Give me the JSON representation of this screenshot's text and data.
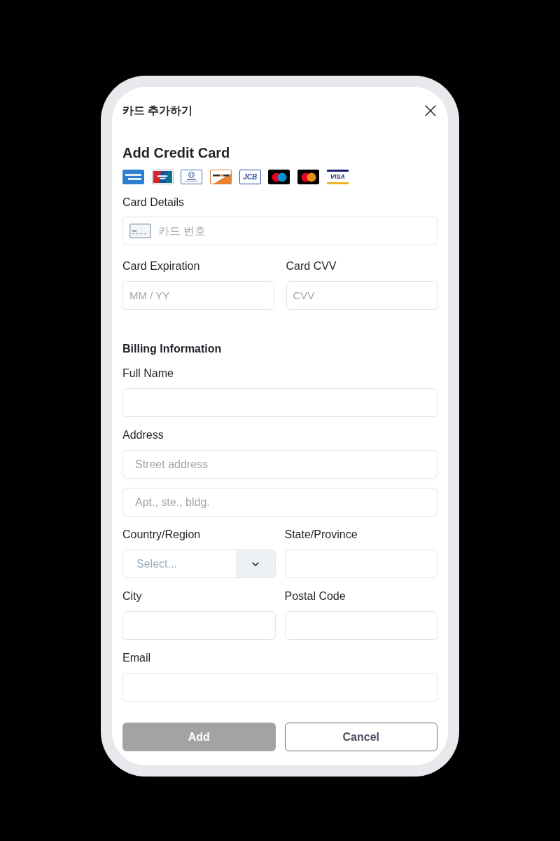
{
  "header": {
    "title": "카드 추가하기"
  },
  "card_form": {
    "title": "Add Credit Card",
    "card_brands": [
      {
        "kind": "amex"
      },
      {
        "kind": "unionpay"
      },
      {
        "kind": "diners"
      },
      {
        "kind": "discover"
      },
      {
        "kind": "jcb",
        "label": "JCB"
      },
      {
        "kind": "maestro"
      },
      {
        "kind": "mastercard"
      },
      {
        "kind": "visa",
        "label": "VISA"
      }
    ],
    "card_details": {
      "label": "Card Details",
      "placeholder": "카드 번호"
    },
    "card_fields": [
      {
        "label": "Card Expiration",
        "placeholder": "MM / YY"
      },
      {
        "label": "Card CVV",
        "placeholder": "CVV"
      }
    ]
  },
  "billing": {
    "title": "Billing Information",
    "rows": [
      [
        {
          "kind": "input",
          "label": "Full Name"
        }
      ],
      [
        {
          "kind": "address",
          "label": "Address",
          "placeholders": [
            "Street address",
            "Apt., ste., bldg."
          ]
        }
      ],
      [
        {
          "kind": "select",
          "label": "Country/Region",
          "placeholder": "Select..."
        },
        {
          "kind": "input",
          "label": "State/Province"
        }
      ],
      [
        {
          "kind": "input",
          "label": "City"
        },
        {
          "kind": "input",
          "label": "Postal Code"
        }
      ],
      [
        {
          "kind": "input",
          "label": "Email"
        }
      ]
    ]
  },
  "buttons": [
    {
      "kind": "primary",
      "label": "Add",
      "disabled": true
    },
    {
      "kind": "secondary",
      "label": "Cancel",
      "disabled": false
    }
  ]
}
